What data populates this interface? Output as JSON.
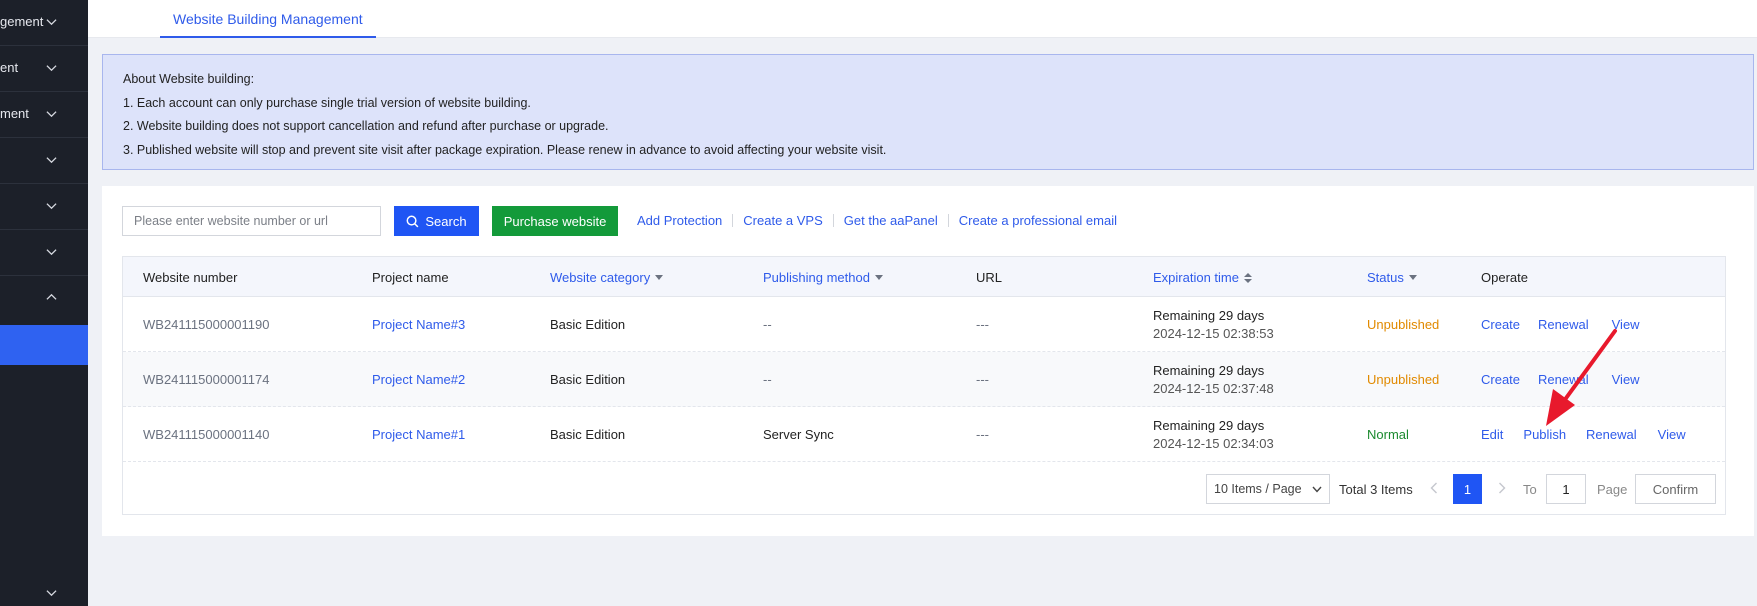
{
  "sidebar": {
    "items": [
      {
        "label": "gement",
        "chevron": "down"
      },
      {
        "label": "ent",
        "chevron": "down"
      },
      {
        "label": "ment",
        "chevron": "down"
      },
      {
        "label": "",
        "chevron": "down"
      },
      {
        "label": "",
        "chevron": "down"
      },
      {
        "label": "",
        "chevron": "down"
      },
      {
        "label": "",
        "chevron": "up"
      },
      {
        "label": "",
        "chevron": "down"
      }
    ],
    "active_color": "#2f62f1"
  },
  "header": {
    "tab_active": "Website Building Management"
  },
  "notice": {
    "title": "About Website building:",
    "lines": [
      "1. Each account can only purchase single trial version of website building.",
      "2. Website building does not support cancellation and refund after purchase or upgrade.",
      "3. Published website will stop and prevent site visit after package expiration. Please renew in advance to avoid affecting your website visit."
    ]
  },
  "toolbar": {
    "search_placeholder": "Please enter website number or url",
    "search_label": "Search",
    "purchase_label": "Purchase website",
    "links": [
      "Add Protection",
      "Create a VPS",
      "Get the aaPanel",
      "Create a professional email"
    ]
  },
  "table": {
    "columns": [
      "Website number",
      "Project name",
      "Website category",
      "Publishing method",
      "URL",
      "Expiration time",
      "Status",
      "Operate"
    ],
    "rows": [
      {
        "number": "WB241115000001190",
        "project": "Project Name#3",
        "category": "Basic Edition",
        "method": "--",
        "url": "---",
        "remaining": "Remaining 29 days",
        "date": "2024-12-15 02:38:53",
        "status": "Unpublished",
        "ops": [
          "Create",
          "Renewal",
          "View"
        ]
      },
      {
        "number": "WB241115000001174",
        "project": "Project Name#2",
        "category": "Basic Edition",
        "method": "--",
        "url": "---",
        "remaining": "Remaining 29 days",
        "date": "2024-12-15 02:37:48",
        "status": "Unpublished",
        "ops": [
          "Create",
          "Renewal",
          "View"
        ]
      },
      {
        "number": "WB241115000001140",
        "project": "Project Name#1",
        "category": "Basic Edition",
        "method": "Server Sync",
        "url": "---",
        "remaining": "Remaining 29 days",
        "date": "2024-12-15 02:34:03",
        "status": "Normal",
        "ops": [
          "Edit",
          "Publish",
          "Renewal",
          "View"
        ]
      }
    ]
  },
  "pagination": {
    "page_size": "10 Items / Page",
    "total": "Total 3 Items",
    "current_page": "1",
    "to_label": "To",
    "goto_value": "1",
    "page_label": "Page",
    "confirm_label": "Confirm"
  },
  "colors": {
    "primary": "#1f55f4",
    "success": "#139a3a",
    "warning": "#e18a00",
    "annotation": "#e8192c"
  }
}
